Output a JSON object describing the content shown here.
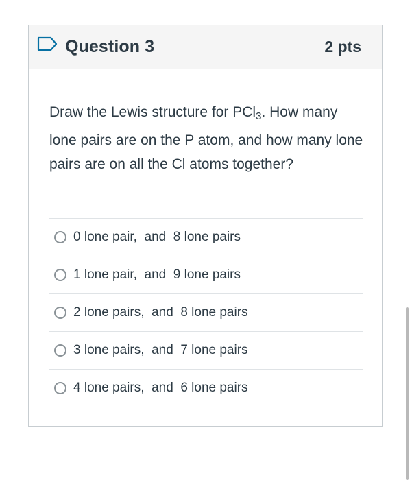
{
  "question": {
    "title": "Question 3",
    "points": "2 pts",
    "flag_icon": "flag-outline-icon",
    "accent_color": "#0770a3",
    "body_before_sub": "Draw the Lewis structure for PCl",
    "body_sub": "3",
    "body_after_sub": ". How many lone pairs are on the P atom, and how many lone pairs are on all the Cl atoms together?"
  },
  "answers": [
    {
      "label": "0 lone pair,  and  8 lone pairs",
      "selected": false
    },
    {
      "label": "1 lone pair,  and  9 lone pairs",
      "selected": false
    },
    {
      "label": "2 lone pairs,  and  8 lone pairs",
      "selected": false
    },
    {
      "label": "3 lone pairs,  and  7 lone pairs",
      "selected": false
    },
    {
      "label": "4 lone pairs,  and  6 lone pairs",
      "selected": false
    }
  ]
}
